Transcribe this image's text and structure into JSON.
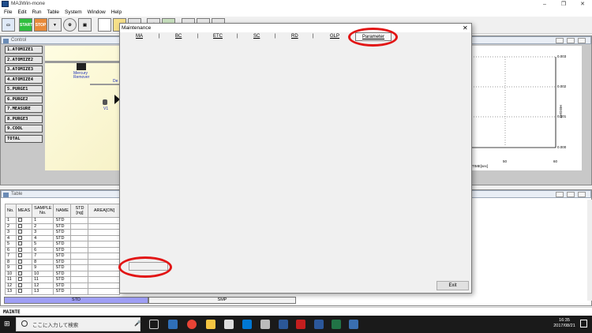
{
  "app": {
    "title": "MA3Win-mone",
    "menu": [
      "File",
      "Edit",
      "Run",
      "Table",
      "System",
      "Window",
      "Help"
    ],
    "window_controls": [
      "–",
      "❐",
      "✕"
    ]
  },
  "toolbar": {
    "start_label": "START",
    "stop_label": "STOP"
  },
  "control_window": {
    "title": "Control",
    "sequence_buttons": [
      "1.ATOMIZE1",
      "2.ATOMIZE2",
      "3.ATOMIZE3",
      "4.ATOMIZE4",
      "5.PURGE1",
      "6.PURGE2",
      "7.MEASURE",
      "8.PURGE3",
      "9.COOL",
      "TOTAL"
    ],
    "diagram": {
      "mercury_remover_label": "Mercury\nRemover",
      "valve_label": "V1",
      "partial_label": "De"
    },
    "chart": {
      "y_ticks": [
        "0.003",
        "0.002",
        "0.001",
        "0.000"
      ],
      "x_ticks": [
        "50",
        "60"
      ],
      "xlabel": "TIME[sec]",
      "ylabel": "HEIGHT"
    }
  },
  "table_window": {
    "title": "Table",
    "columns": [
      "No.",
      "MEAS",
      "SAMPLE No.",
      "NAME",
      "STD [ng]",
      "AREA[ON]"
    ],
    "rows": [
      {
        "no": "1",
        "sample": "1",
        "name": "STD"
      },
      {
        "no": "2",
        "sample": "2",
        "name": "STD"
      },
      {
        "no": "3",
        "sample": "3",
        "name": "STD"
      },
      {
        "no": "4",
        "sample": "4",
        "name": "STD"
      },
      {
        "no": "5",
        "sample": "5",
        "name": "STD"
      },
      {
        "no": "6",
        "sample": "6",
        "name": "STD"
      },
      {
        "no": "7",
        "sample": "7",
        "name": "STD"
      },
      {
        "no": "8",
        "sample": "8",
        "name": "STD"
      },
      {
        "no": "9",
        "sample": "9",
        "name": "STD"
      },
      {
        "no": "10",
        "sample": "10",
        "name": "STD"
      },
      {
        "no": "11",
        "sample": "11",
        "name": "STD"
      },
      {
        "no": "12",
        "sample": "12",
        "name": "STD"
      },
      {
        "no": "13",
        "sample": "13",
        "name": "STD"
      }
    ],
    "bottom_tabs": [
      "STD",
      "SMP"
    ]
  },
  "status_bar": {
    "mode": "MAINTE"
  },
  "dialog": {
    "title": "Maintenance",
    "tabs": [
      "MA",
      "BC",
      "ETC",
      "SC",
      "RD",
      "GLP",
      "Parameter"
    ],
    "exit_label": "Exit",
    "close_icon": "close-icon"
  },
  "taskbar": {
    "search_placeholder": "ここに入力して検索",
    "time": "16:35",
    "date": "2017/08/21"
  },
  "colors": {
    "highlight_oval": "#e21515",
    "tab_active": "#9f9ff5"
  }
}
